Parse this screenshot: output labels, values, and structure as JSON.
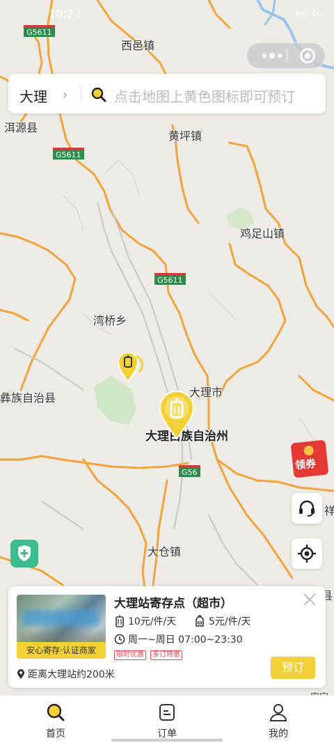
{
  "status_bar": {
    "time": "10:23",
    "network": "HD 4G"
  },
  "capsule": {
    "more_icon": "more-dots-icon",
    "close_icon": "target-close-icon"
  },
  "search": {
    "city": "大理",
    "placeholder": "点击地图上黄色图标即可预订"
  },
  "map": {
    "places": {
      "xiyi": "西邑镇",
      "eryuan": "洱源县",
      "huangping": "黄坪镇",
      "jizushan": "鸡足山镇",
      "wanqiao": "湾桥乡",
      "yizu": "彝族自治县",
      "dalishi": "大理市",
      "dalizhou": "大理白族自治州",
      "dacang": "大仓镇",
      "xiang": "祥",
      "xian": "县",
      "anding": "安定"
    },
    "roads": {
      "g5611_a": "G5611",
      "g5611_b": "G5611",
      "g5611_c": "G5611",
      "g56": "G56"
    }
  },
  "coupon": {
    "label": "领券"
  },
  "card": {
    "name": "大理站寄存点（超市）",
    "badge": "安心寄存·认证商家",
    "price_large": "10元/件/天",
    "price_small": "5元/件/天",
    "hours": "周一~周日 07:00~23:30",
    "tags": [
      "限时优惠",
      "多订特惠"
    ],
    "distance": "距离大理站约200米",
    "book_label": "预订"
  },
  "tabbar": {
    "home": "首页",
    "orders": "订单",
    "mine": "我的"
  },
  "colors": {
    "accent": "#f3d035",
    "road": "#f2a33a",
    "shield": "#2f8a4b",
    "coupon": "#e53935"
  }
}
